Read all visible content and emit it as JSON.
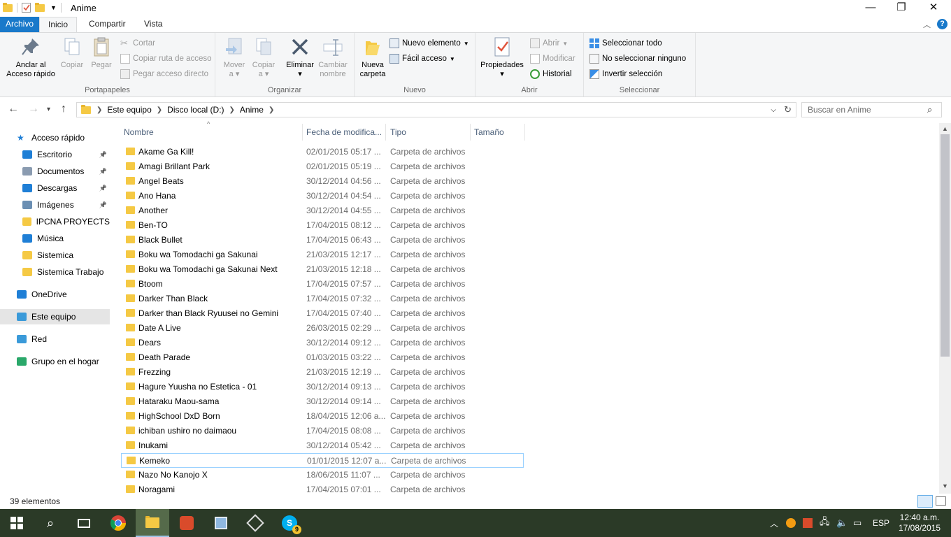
{
  "window": {
    "title": "Anime",
    "min_glyph": "—",
    "max_glyph": "❐",
    "close_glyph": "✕"
  },
  "tabs": {
    "file": "Archivo",
    "home": "Inicio",
    "share": "Compartir",
    "view": "Vista"
  },
  "ribbon": {
    "portapapeles": {
      "label": "Portapapeles",
      "pin": "Anclar al\nAcceso rápido",
      "pin_l1": "Anclar al",
      "pin_l2": "Acceso rápido",
      "copy": "Copiar",
      "paste": "Pegar",
      "cut": "Cortar",
      "copy_path": "Copiar ruta de acceso",
      "paste_shortcut": "Pegar acceso directo"
    },
    "organizar": {
      "label": "Organizar",
      "move_l1": "Mover",
      "move_l2": "a",
      "copy_l1": "Copiar",
      "copy_l2": "a",
      "delete": "Eliminar",
      "rename_l1": "Cambiar",
      "rename_l2": "nombre"
    },
    "nuevo": {
      "label": "Nuevo",
      "new_folder_l1": "Nueva",
      "new_folder_l2": "carpeta",
      "new_item": "Nuevo elemento",
      "easy_access": "Fácil acceso"
    },
    "abrir": {
      "label": "Abrir",
      "properties": "Propiedades",
      "open": "Abrir",
      "edit": "Modificar",
      "history": "Historial"
    },
    "seleccionar": {
      "label": "Seleccionar",
      "select_all": "Seleccionar todo",
      "select_none": "No seleccionar ninguno",
      "invert": "Invertir selección"
    }
  },
  "address": {
    "crumbs": [
      "Este equipo",
      "Disco local (D:)",
      "Anime"
    ],
    "search_placeholder": "Buscar en Anime"
  },
  "nav": {
    "items": [
      {
        "label": "Acceso rápido",
        "icon": "star-icon",
        "pinned": false
      },
      {
        "label": "Escritorio",
        "icon": "desktop-icon",
        "pinned": true
      },
      {
        "label": "Documentos",
        "icon": "documents-icon",
        "pinned": true
      },
      {
        "label": "Descargas",
        "icon": "download-icon",
        "pinned": true
      },
      {
        "label": "Imágenes",
        "icon": "pictures-icon",
        "pinned": true
      },
      {
        "label": "IPCNA PROYECTS",
        "icon": "folder-icon",
        "pinned": false
      },
      {
        "label": "Música",
        "icon": "music-icon",
        "pinned": false
      },
      {
        "label": "Sistemica",
        "icon": "folder-icon",
        "pinned": false
      },
      {
        "label": "Sistemica Trabajo",
        "icon": "folder-icon",
        "pinned": false
      },
      {
        "label": "OneDrive",
        "icon": "cloud-icon",
        "pinned": false
      },
      {
        "label": "Este equipo",
        "icon": "computer-icon",
        "pinned": false
      },
      {
        "label": "Red",
        "icon": "network-icon",
        "pinned": false
      },
      {
        "label": "Grupo en el hogar",
        "icon": "homegroup-icon",
        "pinned": false
      }
    ]
  },
  "columns": {
    "name": "Nombre",
    "date": "Fecha de modifica...",
    "type": "Tipo",
    "size": "Tamaño"
  },
  "files": [
    {
      "name": "Akame Ga Kill!",
      "date": "02/01/2015 05:17 ...",
      "type": "Carpeta de archivos"
    },
    {
      "name": "Amagi Brillant Park",
      "date": "02/01/2015 05:19 ...",
      "type": "Carpeta de archivos"
    },
    {
      "name": "Angel Beats",
      "date": "30/12/2014 04:56 ...",
      "type": "Carpeta de archivos"
    },
    {
      "name": "Ano Hana",
      "date": "30/12/2014 04:54 ...",
      "type": "Carpeta de archivos"
    },
    {
      "name": "Another",
      "date": "30/12/2014 04:55 ...",
      "type": "Carpeta de archivos"
    },
    {
      "name": "Ben-TO",
      "date": "17/04/2015 08:12 ...",
      "type": "Carpeta de archivos"
    },
    {
      "name": "Black Bullet",
      "date": "17/04/2015 06:43 ...",
      "type": "Carpeta de archivos"
    },
    {
      "name": "Boku wa Tomodachi ga Sakunai",
      "date": "21/03/2015 12:17 ...",
      "type": "Carpeta de archivos"
    },
    {
      "name": "Boku wa Tomodachi ga Sakunai Next",
      "date": "21/03/2015 12:18 ...",
      "type": "Carpeta de archivos"
    },
    {
      "name": "Btoom",
      "date": "17/04/2015 07:57 ...",
      "type": "Carpeta de archivos"
    },
    {
      "name": "Darker Than Black",
      "date": "17/04/2015 07:32 ...",
      "type": "Carpeta de archivos"
    },
    {
      "name": "Darker than Black Ryuusei no Gemini",
      "date": "17/04/2015 07:40 ...",
      "type": "Carpeta de archivos"
    },
    {
      "name": "Date A Live",
      "date": "26/03/2015 02:29 ...",
      "type": "Carpeta de archivos"
    },
    {
      "name": "Dears",
      "date": "30/12/2014 09:12 ...",
      "type": "Carpeta de archivos"
    },
    {
      "name": "Death Parade",
      "date": "01/03/2015 03:22 ...",
      "type": "Carpeta de archivos"
    },
    {
      "name": "Frezzing",
      "date": "21/03/2015 12:19 ...",
      "type": "Carpeta de archivos"
    },
    {
      "name": "Hagure Yuusha no Estetica - 01",
      "date": "30/12/2014 09:13 ...",
      "type": "Carpeta de archivos"
    },
    {
      "name": "Hataraku Maou-sama",
      "date": "30/12/2014 09:14 ...",
      "type": "Carpeta de archivos"
    },
    {
      "name": "HighSchool DxD Born",
      "date": "18/04/2015 12:06 a...",
      "type": "Carpeta de archivos"
    },
    {
      "name": "ichiban ushiro no daimaou",
      "date": "17/04/2015 08:08 ...",
      "type": "Carpeta de archivos"
    },
    {
      "name": "Inukami",
      "date": "30/12/2014 05:42 ...",
      "type": "Carpeta de archivos"
    },
    {
      "name": "Kemeko",
      "date": "01/01/2015 12:07 a...",
      "type": "Carpeta de archivos",
      "selected": true
    },
    {
      "name": "Nazo No Kanojo X",
      "date": "18/06/2015 11:07 ...",
      "type": "Carpeta de archivos"
    },
    {
      "name": "Noragami",
      "date": "17/04/2015 07:01 ...",
      "type": "Carpeta de archivos"
    }
  ],
  "status": {
    "count": "39 elementos"
  },
  "taskbar": {
    "time": "12:40 a.m.",
    "date": "17/08/2015",
    "lang": "ESP",
    "skype_badge": "9"
  }
}
